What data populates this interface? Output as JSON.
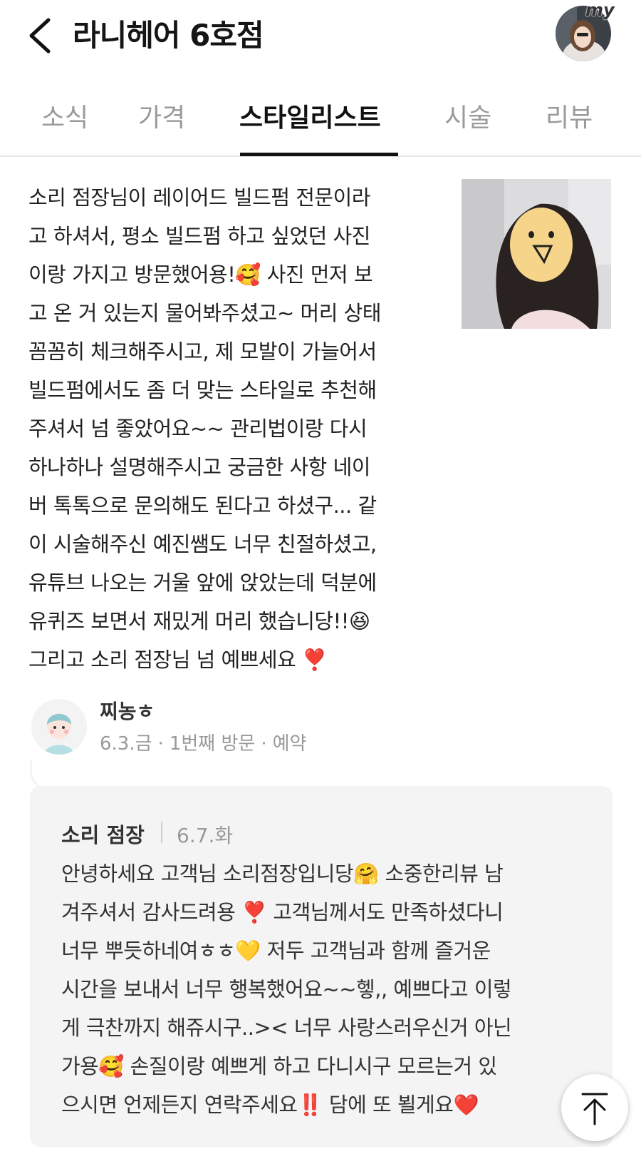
{
  "header": {
    "title": "라니헤어 6호점",
    "back_icon": "chevron-left-icon",
    "my_label": "my"
  },
  "tabs": [
    {
      "label": "소식",
      "active": false
    },
    {
      "label": "가격",
      "active": false
    },
    {
      "label": "스타일리스트",
      "active": true
    },
    {
      "label": "시술",
      "active": false
    },
    {
      "label": "리뷰",
      "active": false
    }
  ],
  "review": {
    "text": "소리 점장님이 레이어드 빌드펌 전문이라\n고 하셔서, 평소 빌드펌 하고 싶었던 사진\n이랑 가지고 방문했어용!🥰 사진 먼저 보\n고 온 거 있는지 물어봐주셨고~ 머리 상태\n꼼꼼히 체크해주시고, 제 모발이 가늘어서\n빌드펌에서도 좀 더 맞는 스타일로 추천해\n주셔서 넘 좋았어요~~ 관리법이랑 다시\n하나하나 설명해주시고 궁금한 사항 네이\n버 톡톡으로 문의해도 된다고 하셨구... 같\n이 시술해주신 예진쌤도 너무 친절하셨고,\n유튜브 나오는 거울 앞에 앉았는데 덕분에\n유퀴즈 보면서 재밌게 머리 했습니당!!😆\n그리고 소리 점장님 넘 예쁘세요 ❣️",
    "reviewer": {
      "name": "찌농ㅎ",
      "date": "6.3.금",
      "visit": "1번째 방문",
      "type": "예약",
      "separator": "·"
    }
  },
  "reply": {
    "author": "소리 점장",
    "date": "6.7.화",
    "text": "안녕하세요 고객님 소리점장입니당🤗 소중한리뷰 남\n겨주셔서 감사드려용 ❣️ 고객님께서도 만족하셨다니\n너무 뿌듯하네여ㅎㅎ💛 저두 고객님과 함께 즐거운\n시간을 보내서 너무 행복했어요~~헿,, 예쁘다고 이렇\n게 극찬까지 해쥬시구..>< 너무 사랑스러우신거 아닌\n가용🥰 손질이랑 예쁘게 하고 다니시구 모르는거 있\n으시면 언제든지 연락주세요‼️ 담에 또 뵐게요❤️"
  },
  "scroll_top_icon": "arrow-up-to-top-icon"
}
